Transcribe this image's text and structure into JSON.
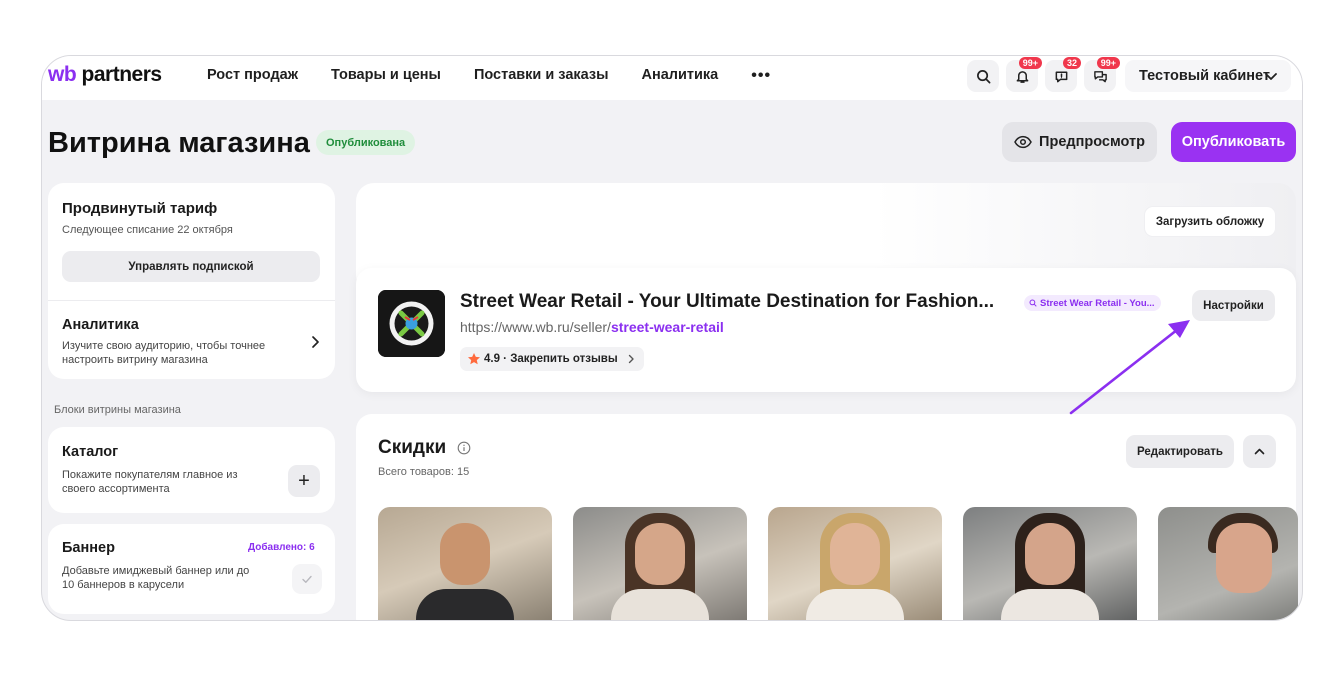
{
  "nav": {
    "logo_wb": "wb",
    "logo_partners": "partners",
    "menu": [
      "Рост продаж",
      "Товары и цены",
      "Поставки и заказы",
      "Аналитика"
    ],
    "more": "•••",
    "badges": {
      "notifications": "99+",
      "feedback": "32",
      "chat": "99+"
    },
    "cabinet": "Тестовый кабинет"
  },
  "header": {
    "title": "Витрина магазина",
    "status": "Опубликована",
    "preview": "Предпросмотр",
    "publish": "Опубликовать"
  },
  "sidebar": {
    "tariff": {
      "title": "Продвинутый тариф",
      "subtitle": "Следующее списание 22 октября",
      "manage": "Управлять подпиской"
    },
    "analytics": {
      "title": "Аналитика",
      "desc": "Изучите свою аудиторию, чтобы точнее настроить витрину магазина"
    },
    "blocks_label": "Блоки витрины магазина",
    "catalog": {
      "title": "Каталог",
      "desc": "Покажите покупателям главное из своего ассортимента"
    },
    "banner": {
      "title": "Баннер",
      "added": "Добавлено: 6",
      "desc": "Добавьте имиджевый баннер или до 10 баннеров в карусели"
    }
  },
  "cover": {
    "upload": "Загрузить обложку"
  },
  "store": {
    "name": "Street Wear Retail - Your Ultimate Destination for Fashion...",
    "url_prefix": "https://www.wb.ru/seller/",
    "url_slug": "street-wear-retail",
    "rating": "4.9 · Закрепить отзывы",
    "search_tag": "Street Wear Retail - You...",
    "settings": "Настройки"
  },
  "discounts": {
    "title": "Скидки",
    "count": "Всего товаров: 15",
    "edit": "Редактировать"
  },
  "colors": {
    "accent": "#9a32f2",
    "status_green": "#1f8d3b",
    "badge_red": "#f0374c"
  }
}
